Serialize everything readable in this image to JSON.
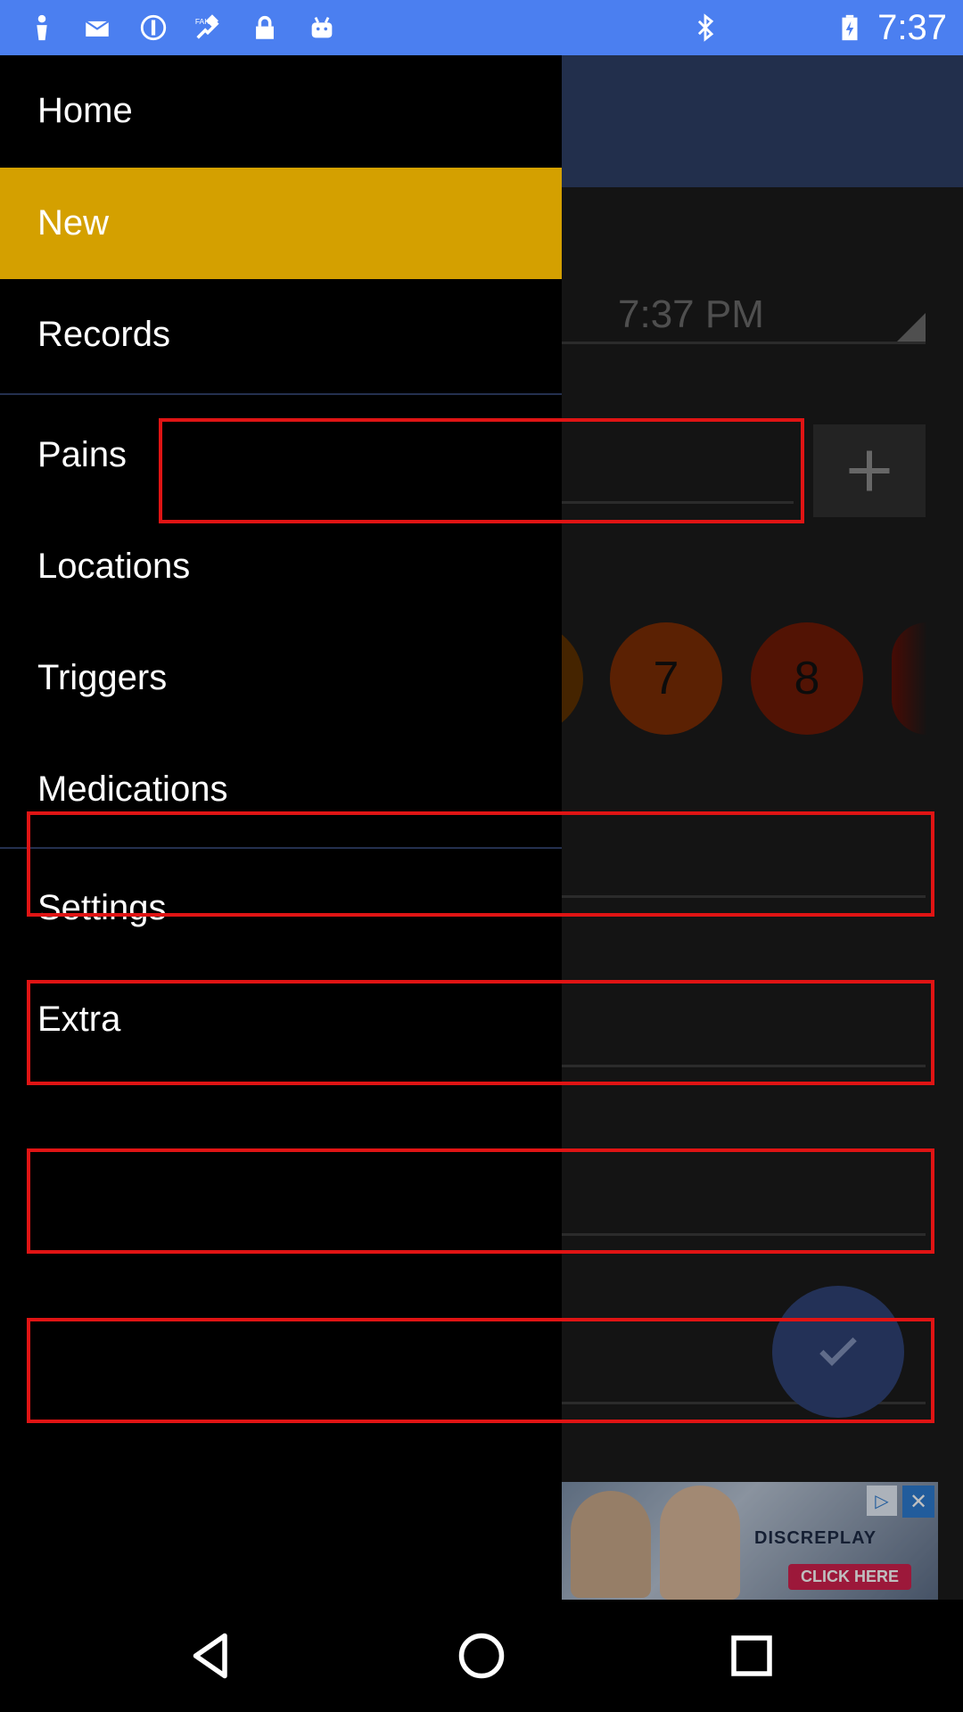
{
  "status_bar": {
    "time": "7:37",
    "left_icons": [
      "person-icon",
      "mail-icon",
      "info-circle-icon",
      "fake-gps-icon",
      "lock-icon",
      "android-icon"
    ],
    "right_icons": [
      "bluetooth-icon",
      "battery-charging-icon"
    ],
    "bg_color": "#4b7ff0"
  },
  "background": {
    "time_value": "7:37 PM",
    "pain_level_circles": [
      {
        "label": "7",
        "color": "#7a2c05"
      },
      {
        "label": "8",
        "color": "#6e1a06"
      }
    ]
  },
  "drawer": {
    "items": [
      {
        "label": "Home",
        "selected": false
      },
      {
        "label": "New",
        "selected": true
      },
      {
        "label": "Records",
        "selected": false
      },
      {
        "label": "Pains",
        "selected": false
      },
      {
        "label": "Locations",
        "selected": false
      },
      {
        "label": "Triggers",
        "selected": false
      },
      {
        "label": "Medications",
        "selected": false
      },
      {
        "label": "Settings",
        "selected": false
      },
      {
        "label": "Extra",
        "selected": false
      }
    ],
    "selected_color": "#d4a000"
  },
  "ad": {
    "brand": "DISCREPLAY",
    "cta": "CLICK HERE",
    "info_glyph": "▷",
    "close_glyph": "✕"
  },
  "nav_bar": {
    "buttons": [
      "back-icon",
      "home-icon",
      "recents-icon"
    ]
  },
  "highlight_color": "#e01414"
}
